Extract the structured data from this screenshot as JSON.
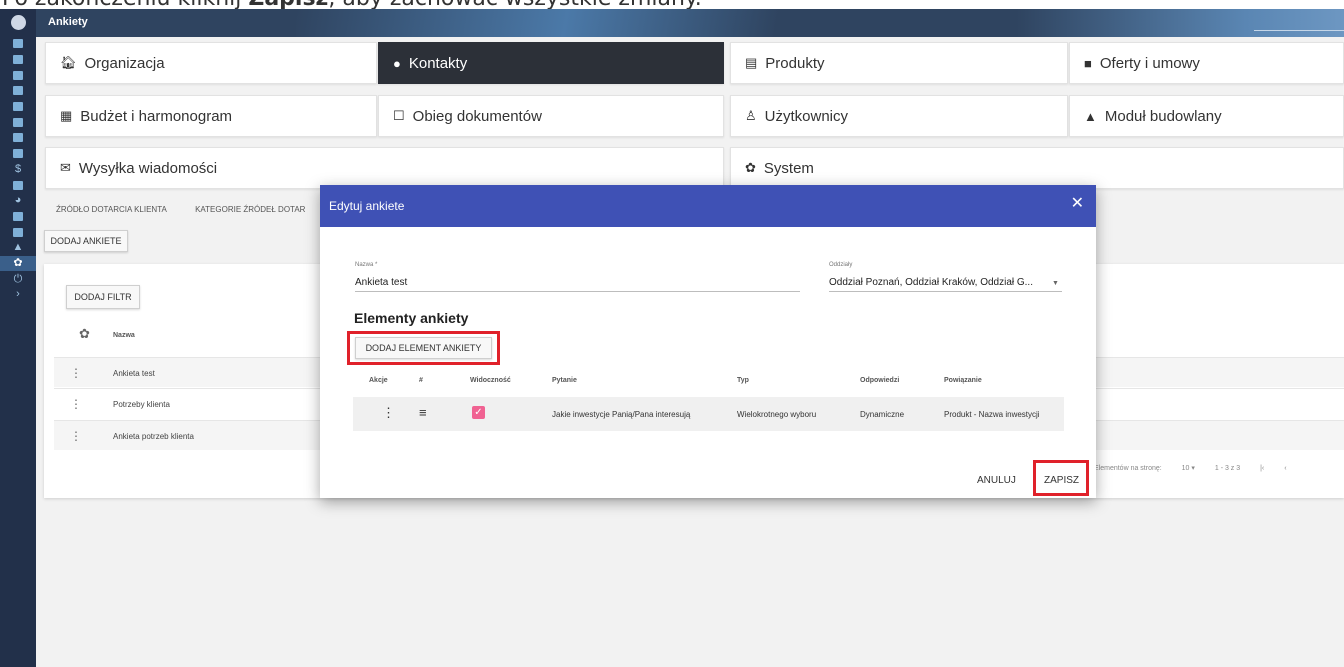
{
  "caption": {
    "prefix": "Po zakończeniu kliknij ",
    "bold": "Zapisz",
    "suffix": ", aby zachować wszystkie zmiany."
  },
  "header": {
    "title": "Ankiety"
  },
  "sidebar": {
    "icons": [
      "dashboard-icon",
      "calendar-icon",
      "users-icon",
      "building-icon",
      "store-icon",
      "briefcase-icon",
      "folder-icon",
      "monitor-icon",
      "dollar-icon",
      "document-icon",
      "pie-chart-icon",
      "bar-chart-icon",
      "card-icon",
      "warning-icon",
      "gear-icon",
      "power-icon",
      "chevron-right-icon"
    ]
  },
  "tiles": {
    "organizacja": "Organizacja",
    "kontakty": "Kontakty",
    "produkty": "Produkty",
    "oferty": "Oferty i umowy",
    "budzet": "Budżet i harmonogram",
    "obieg": "Obieg dokumentów",
    "uzytkownicy": "Użytkownicy",
    "modul": "Moduł budowlany",
    "wysylka": "Wysyłka wiadomości",
    "system": "System"
  },
  "subtabs": [
    "ŹRÓDŁO DOTARCIA KLIENTA",
    "KATEGORIE ŹRÓDEŁ DOTAR"
  ],
  "buttons": {
    "add_survey": "DODAJ ANKIETE",
    "add_filter": "DODAJ FILTR"
  },
  "list": {
    "col_name": "Nazwa",
    "rows": [
      "Ankieta test",
      "Potrzeby klienta",
      "Ankieta potrzeb klienta"
    ],
    "pager_label": "Elementów na stronę:",
    "pager_size": "10 ▾",
    "pager_range": "1 - 3 z 3"
  },
  "modal": {
    "title": "Edytuj ankiete",
    "name_label": "Nazwa *",
    "name_value": "Ankieta test",
    "branches_label": "Oddziały",
    "branches_value": "Oddział Poznań, Oddział Kraków, Oddział G...",
    "section_title": "Elementy ankiety",
    "add_element": "DODAJ ELEMENT ANKIETY",
    "columns": [
      "Akcje",
      "#",
      "Widoczność",
      "Pytanie",
      "Typ",
      "Odpowiedzi",
      "Powiązanie"
    ],
    "row": {
      "question": "Jakie inwestycje Panią/Pana interesują",
      "type": "Wielokrotnego wyboru",
      "answers": "Dynamiczne",
      "relation": "Produkt - Nazwa inwestycji"
    },
    "cancel": "ANULUJ",
    "save": "ZAPISZ"
  },
  "colors": {
    "accent": "#3f51b5",
    "highlight": "#e0212a",
    "checkbox": "#f06292",
    "sidebar": "#22304a"
  }
}
